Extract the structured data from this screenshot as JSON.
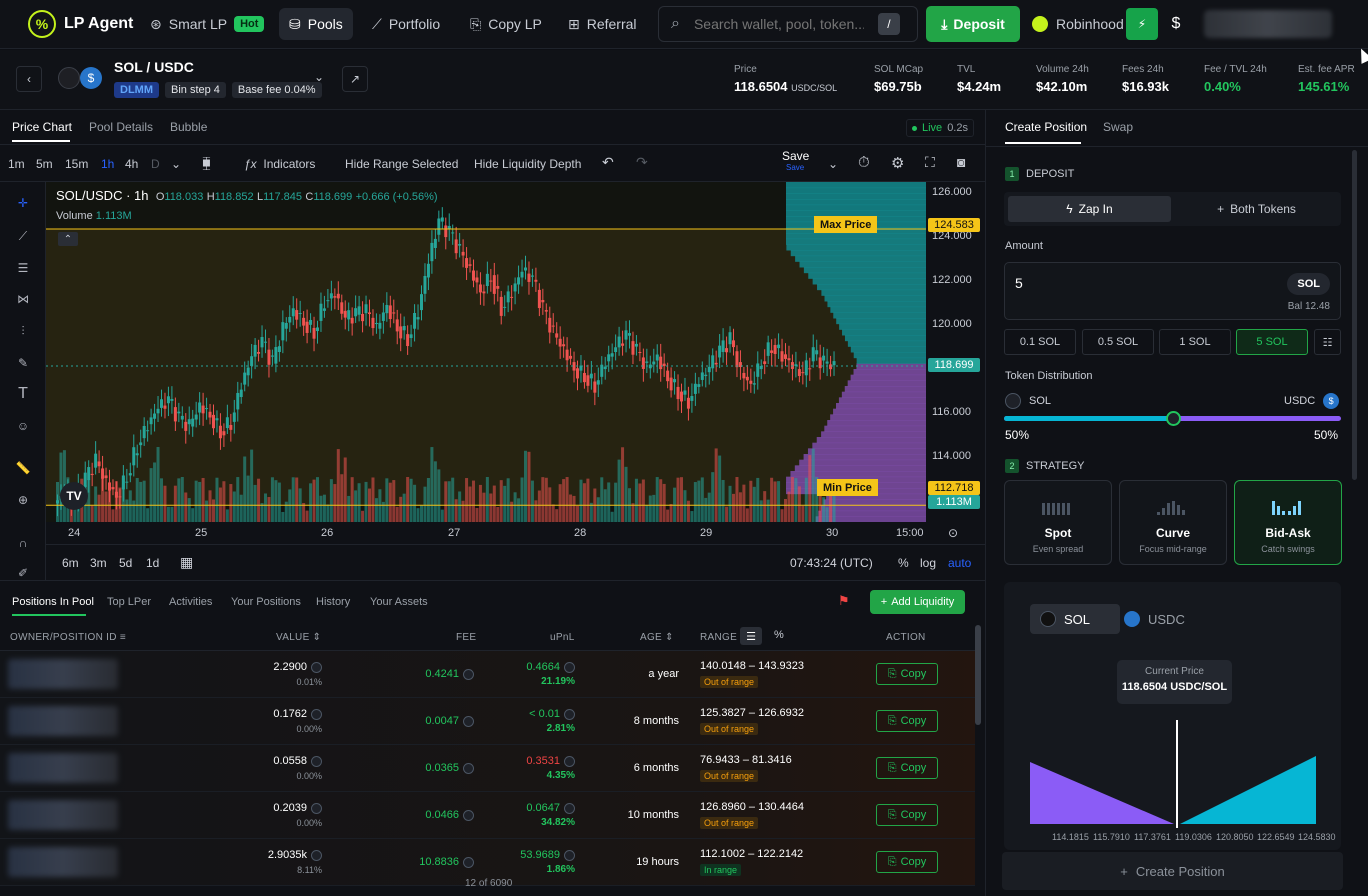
{
  "nav": {
    "brand": "LP Agent",
    "items": [
      {
        "label": "Smart LP",
        "badge": "Hot"
      },
      {
        "label": "Pools"
      },
      {
        "label": "Portfolio"
      },
      {
        "label": "Copy LP"
      },
      {
        "label": "Referral"
      }
    ],
    "search_placeholder": "Search wallet, pool, token...",
    "search_shortcut": "/",
    "deposit_label": "Deposit",
    "robinhood_label": "Robinhood",
    "currency_symbol": "$"
  },
  "pair": {
    "name": "SOL / USDC",
    "tags": [
      "DLMM",
      "Bin step 4",
      "Base fee 0.04%"
    ],
    "stats": [
      {
        "label": "Price",
        "value": "118.6504",
        "unit": "USDC/SOL"
      },
      {
        "label": "SOL MCap",
        "value": "$69.75b"
      },
      {
        "label": "TVL",
        "value": "$4.24m"
      },
      {
        "label": "Volume 24h",
        "value": "$42.10m"
      },
      {
        "label": "Fees 24h",
        "value": "$16.93k"
      },
      {
        "label": "Fee / TVL 24h",
        "value": "0.40%"
      },
      {
        "label": "Est. fee APR",
        "value": "145.61%"
      }
    ]
  },
  "chart_tabs": [
    "Price Chart",
    "Pool Details",
    "Bubble"
  ],
  "live": {
    "label": "Live",
    "latency": "0.2s"
  },
  "toolbar": {
    "intervals": [
      "1m",
      "5m",
      "15m",
      "1h",
      "4h",
      "D"
    ],
    "indicators": "Indicators",
    "hide_range": "Hide Range Selected",
    "hide_depth": "Hide Liquidity Depth",
    "save": "Save",
    "save_sub": "Save"
  },
  "legend": {
    "symbol": "SOL/USDC · 1h",
    "o": "118.033",
    "h": "118.852",
    "l": "117.845",
    "c": "118.699",
    "change": "+0.666 (+0.56%)",
    "volume_label": "Volume",
    "volume_value": "1.113M",
    "o_label": "O",
    "h_label": "H",
    "l_label": "L",
    "c_label": "C"
  },
  "range_labels": {
    "max": "Max Price",
    "min": "Min Price"
  },
  "chart_data": {
    "type": "candlestick",
    "x_labels": [
      "24",
      "25",
      "26",
      "27",
      "28",
      "29",
      "30",
      "15:00"
    ],
    "y_ticks": [
      "126.000",
      "124.000",
      "122.000",
      "120.000",
      "118.000",
      "116.000",
      "114.000"
    ],
    "ylim": [
      112.0,
      126.6
    ],
    "max_price": "124.583",
    "min_price": "112.718",
    "last_price": "118.699",
    "volume_badge": "1.113M",
    "close_path": [
      113.2,
      112.9,
      113.8,
      114.6,
      113.7,
      113.1,
      114.0,
      115.3,
      116.2,
      116.9,
      117.2,
      116.4,
      116.1,
      117.0,
      116.6,
      115.9,
      116.3,
      117.9,
      119.1,
      119.7,
      118.8,
      120.3,
      121.1,
      120.6,
      120.2,
      121.5,
      121.8,
      120.7,
      120.9,
      121.0,
      120.3,
      121.3,
      120.4,
      119.9,
      121.1,
      123.2,
      124.9,
      124.4,
      123.6,
      122.8,
      121.9,
      122.6,
      121.2,
      121.9,
      122.8,
      122.4,
      121.1,
      120.1,
      119.4,
      118.6,
      118.3,
      117.9,
      118.9,
      119.5,
      120.0,
      119.3,
      118.6,
      119.1,
      118.2,
      117.6,
      117.2,
      118.1,
      118.6,
      119.3,
      119.8,
      118.4,
      117.9,
      118.9,
      119.6,
      119.2,
      118.7,
      118.3,
      119.2,
      118.8,
      118.699
    ]
  },
  "chart_footer": {
    "ranges": [
      "6m",
      "3m",
      "5d",
      "1d"
    ],
    "time": "07:43:24 (UTC)",
    "pct": "%",
    "log": "log",
    "auto": "auto"
  },
  "table": {
    "tabs": [
      "Positions In Pool",
      "Top LPer",
      "Activities",
      "Your Positions",
      "History",
      "Your Assets"
    ],
    "add_liquidity": "Add Liquidity",
    "headers": [
      "OWNER/POSITION ID",
      "VALUE",
      "FEE",
      "uPnL",
      "AGE",
      "RANGE",
      "ACTION"
    ],
    "rows": [
      {
        "value": "2.2900",
        "value_pct": "0.01%",
        "fee": "0.4241",
        "upnl": "0.4664",
        "upnl_pct": "21.19%",
        "upnl_color": "#22c55e",
        "age": "a year",
        "range": "140.0148 – 143.9323",
        "status": "Out of range",
        "action": "Copy"
      },
      {
        "value": "0.1762",
        "value_pct": "0.00%",
        "fee": "0.0047",
        "upnl": "< 0.01",
        "upnl_pct": "2.81%",
        "upnl_color": "#22c55e",
        "age": "8 months",
        "range": "125.3827 – 126.6932",
        "status": "Out of range",
        "action": "Copy"
      },
      {
        "value": "0.0558",
        "value_pct": "0.00%",
        "fee": "0.0365",
        "upnl": "0.3531",
        "upnl_pct": "4.35%",
        "upnl_color": "#ef4444",
        "age": "6 months",
        "range": "76.9433 – 81.3416",
        "status": "Out of range",
        "action": "Copy"
      },
      {
        "value": "0.2039",
        "value_pct": "0.00%",
        "fee": "0.0466",
        "upnl": "0.0647",
        "upnl_pct": "34.82%",
        "upnl_color": "#22c55e",
        "age": "10 months",
        "range": "126.8960 – 130.4464",
        "status": "Out of range",
        "action": "Copy"
      },
      {
        "value": "2.9035k",
        "value_pct": "8.11%",
        "fee": "10.8836",
        "upnl": "53.9689",
        "upnl_pct": "1.86%",
        "upnl_color": "#22c55e",
        "age": "19 hours",
        "range": "112.1002 – 122.2142",
        "status": "In range",
        "action": "Copy"
      }
    ],
    "count": "12 of 6090"
  },
  "panel": {
    "tabs": [
      "Create Position",
      "Swap"
    ],
    "step1": "DEPOSIT",
    "step1_no": "1",
    "zap": "Zap In",
    "both": "Both Tokens",
    "amount_label": "Amount",
    "amount_value": "5",
    "token": "SOL",
    "balance": "Bal 12.48",
    "quick": [
      "0.1 SOL",
      "0.5 SOL",
      "1 SOL",
      "5 SOL"
    ],
    "dist_label": "Token Distribution",
    "dist_left_token": "SOL",
    "dist_right_token": "USDC",
    "dist_left_pct": "50%",
    "dist_right_pct": "50%",
    "split": 0.5,
    "step2": "STRATEGY",
    "step2_no": "2",
    "strategies": [
      {
        "name": "Spot",
        "desc": "Even spread"
      },
      {
        "name": "Curve",
        "desc": "Focus mid-range"
      },
      {
        "name": "Bid-Ask",
        "desc": "Catch swings"
      }
    ],
    "preview_tokens": [
      "SOL",
      "USDC"
    ],
    "current_price_label": "Current Price",
    "current_price_value": "118.6504 USDC/SOL",
    "bins_x": [
      "114.1815",
      "115.7910",
      "117.3761",
      "119.0306",
      "120.8050",
      "122.6549",
      "124.5830"
    ],
    "create": "Create Position"
  }
}
